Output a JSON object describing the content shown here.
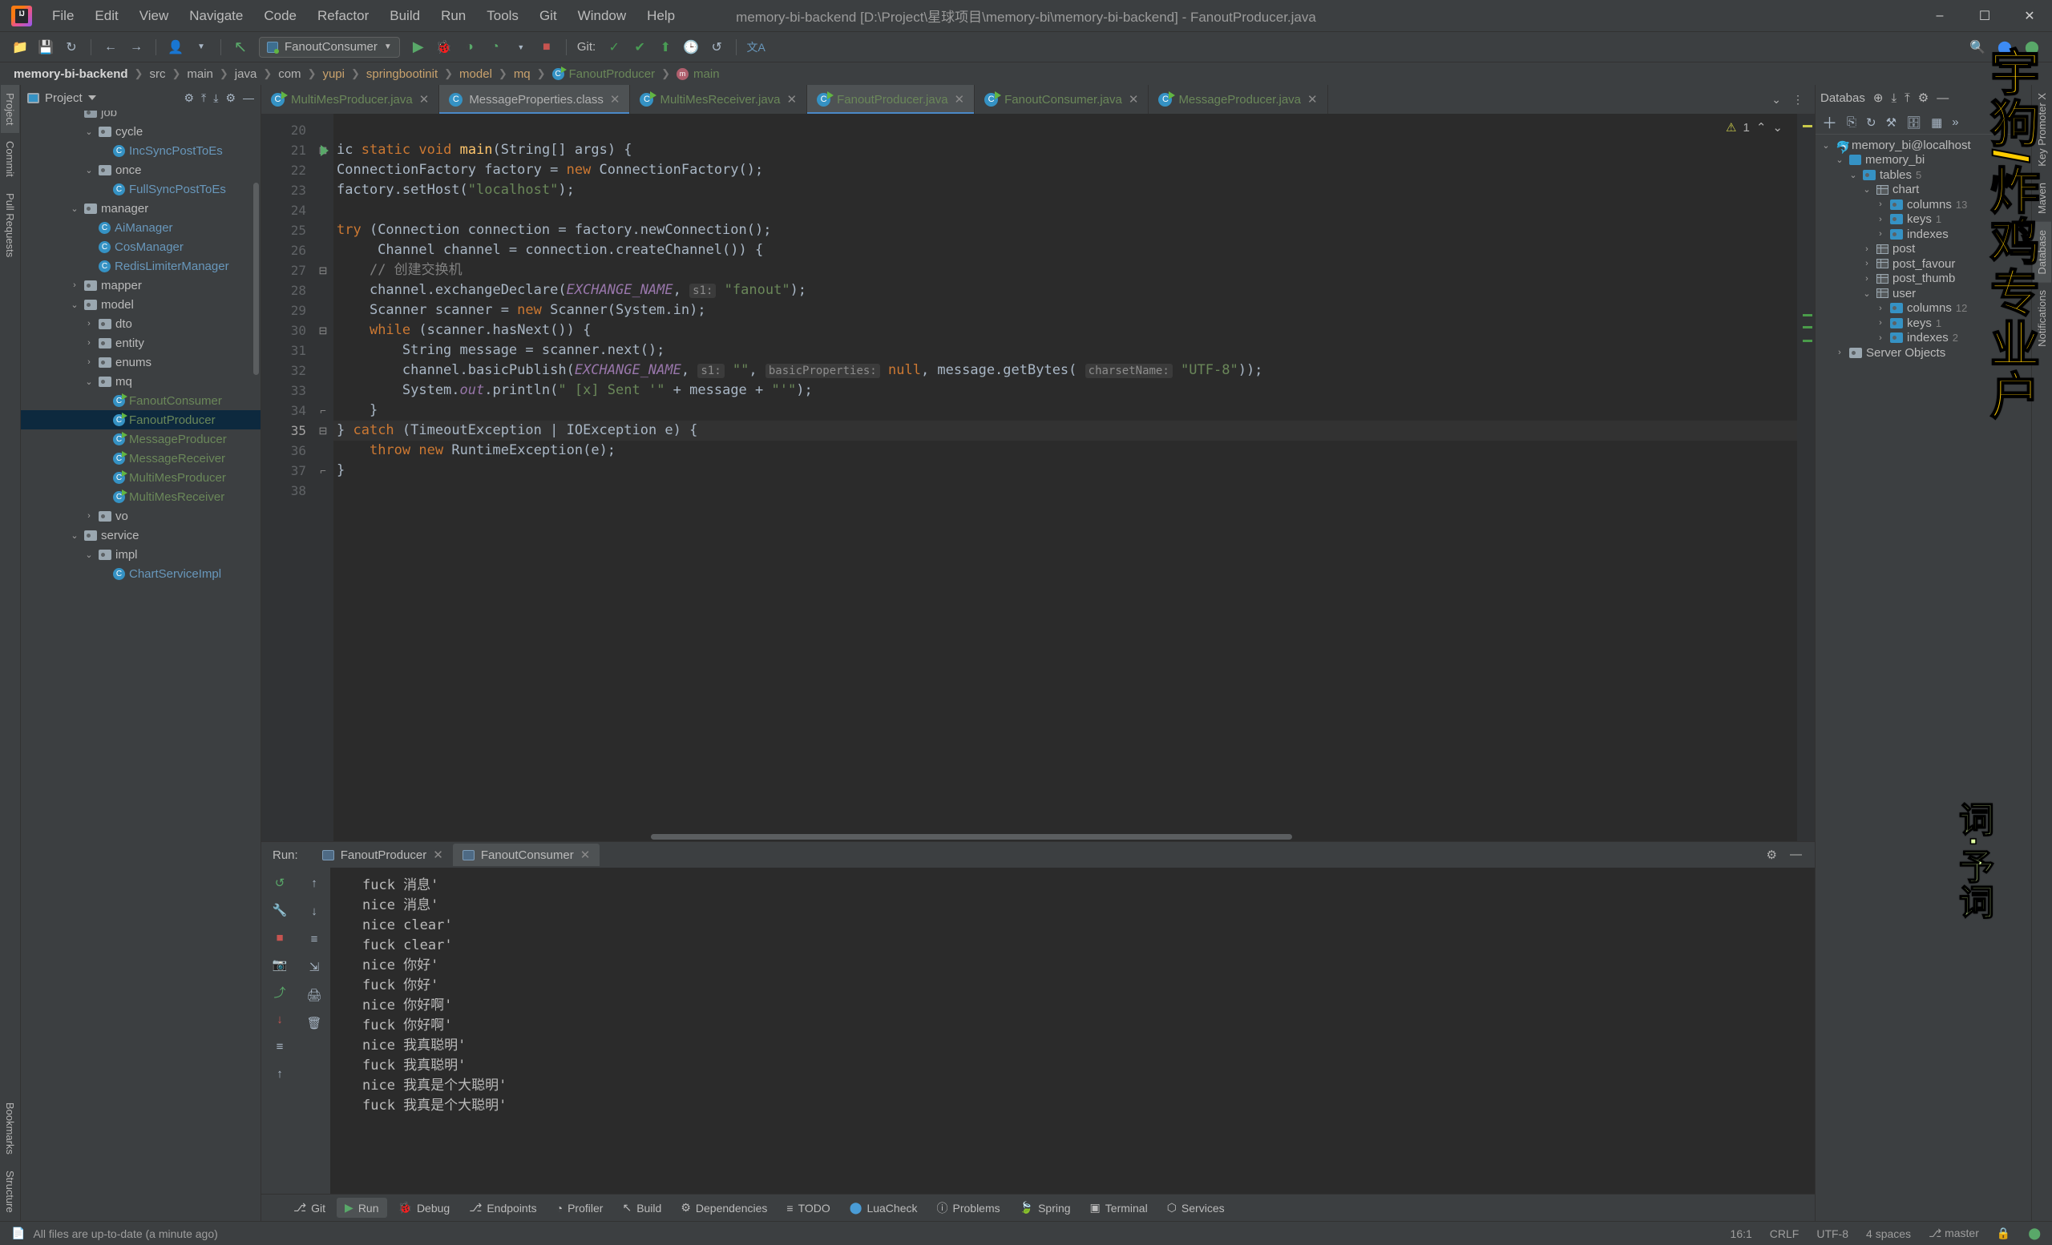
{
  "window": {
    "title": "memory-bi-backend [D:\\Project\\星球项目\\memory-bi\\memory-bi-backend] - FanoutProducer.java",
    "minimize": "–",
    "maximize": "☐",
    "close": "✕"
  },
  "menu": [
    "File",
    "Edit",
    "View",
    "Navigate",
    "Code",
    "Refactor",
    "Build",
    "Run",
    "Tools",
    "Git",
    "Window",
    "Help"
  ],
  "toolbar": {
    "open_icon": "📁",
    "save_icon": "💾",
    "sync_icon": "↻",
    "back_icon": "←",
    "forward_icon": "→",
    "profile_icon": "👤",
    "build_icon": "↖",
    "run_config": "FanoutConsumer",
    "run_icon": "▶",
    "debug_icon": "🐞",
    "coverage_icon": "◑",
    "profiler_icon": "◔",
    "stop_icon": "■",
    "git_label": "Git:",
    "git_update_icon": "✓",
    "git_commit_icon": "✔",
    "git_push_icon": "⬆",
    "git_history_icon": "🕒",
    "git_rollback_icon": "↺",
    "translate_icon": "文A",
    "search_icon": "🔍",
    "assistant_icon": "⬤",
    "ide_icon": "⬤"
  },
  "breadcrumb": [
    {
      "label": "memory-bi-backend",
      "type": "project"
    },
    {
      "label": "src",
      "type": "folder"
    },
    {
      "label": "main",
      "type": "folder"
    },
    {
      "label": "java",
      "type": "folder"
    },
    {
      "label": "com",
      "type": "folder"
    },
    {
      "label": "yupi",
      "type": "folder"
    },
    {
      "label": "springbootinit",
      "type": "folder"
    },
    {
      "label": "model",
      "type": "folder"
    },
    {
      "label": "mq",
      "type": "folder"
    },
    {
      "label": "FanoutProducer",
      "type": "class"
    },
    {
      "label": "main",
      "type": "method"
    }
  ],
  "project_panel": {
    "title": "Project",
    "settings_icon": "⚙",
    "collapse_icon": "⤓",
    "expand_icon": "⤒",
    "gear_icon": "⚙",
    "hide_icon": "—",
    "tree": [
      {
        "indent": 3,
        "arrow": "",
        "icon": "folder",
        "label": "job",
        "color": "plain",
        "cut": true
      },
      {
        "indent": 4,
        "arrow": "v",
        "icon": "folder",
        "label": "cycle",
        "color": "plain"
      },
      {
        "indent": 5,
        "arrow": "",
        "icon": "class",
        "label": "IncSyncPostToEs",
        "color": "blue"
      },
      {
        "indent": 4,
        "arrow": "v",
        "icon": "folder",
        "label": "once",
        "color": "plain"
      },
      {
        "indent": 5,
        "arrow": "",
        "icon": "class",
        "label": "FullSyncPostToEs",
        "color": "blue"
      },
      {
        "indent": 3,
        "arrow": "v",
        "icon": "folder",
        "label": "manager",
        "color": "plain"
      },
      {
        "indent": 4,
        "arrow": "",
        "icon": "class",
        "label": "AiManager",
        "color": "blue"
      },
      {
        "indent": 4,
        "arrow": "",
        "icon": "class",
        "label": "CosManager",
        "color": "blue"
      },
      {
        "indent": 4,
        "arrow": "",
        "icon": "class",
        "label": "RedisLimiterManager",
        "color": "blue"
      },
      {
        "indent": 3,
        "arrow": ">",
        "icon": "folder",
        "label": "mapper",
        "color": "plain"
      },
      {
        "indent": 3,
        "arrow": "v",
        "icon": "folder",
        "label": "model",
        "color": "plain"
      },
      {
        "indent": 4,
        "arrow": ">",
        "icon": "folder",
        "label": "dto",
        "color": "plain"
      },
      {
        "indent": 4,
        "arrow": ">",
        "icon": "folder",
        "label": "entity",
        "color": "plain"
      },
      {
        "indent": 4,
        "arrow": ">",
        "icon": "folder",
        "label": "enums",
        "color": "plain"
      },
      {
        "indent": 4,
        "arrow": "v",
        "icon": "folder",
        "label": "mq",
        "color": "plain"
      },
      {
        "indent": 5,
        "arrow": "",
        "icon": "runclass",
        "label": "FanoutConsumer",
        "color": "green"
      },
      {
        "indent": 5,
        "arrow": "",
        "icon": "runclass",
        "label": "FanoutProducer",
        "color": "green",
        "selected": true
      },
      {
        "indent": 5,
        "arrow": "",
        "icon": "runclass",
        "label": "MessageProducer",
        "color": "green"
      },
      {
        "indent": 5,
        "arrow": "",
        "icon": "runclass",
        "label": "MessageReceiver",
        "color": "green"
      },
      {
        "indent": 5,
        "arrow": "",
        "icon": "runclass",
        "label": "MultiMesProducer",
        "color": "green"
      },
      {
        "indent": 5,
        "arrow": "",
        "icon": "runclass",
        "label": "MultiMesReceiver",
        "color": "green"
      },
      {
        "indent": 4,
        "arrow": ">",
        "icon": "folder",
        "label": "vo",
        "color": "plain"
      },
      {
        "indent": 3,
        "arrow": "v",
        "icon": "folder",
        "label": "service",
        "color": "plain"
      },
      {
        "indent": 4,
        "arrow": "v",
        "icon": "folder",
        "label": "impl",
        "color": "plain"
      },
      {
        "indent": 5,
        "arrow": "",
        "icon": "class",
        "label": "ChartServiceImpl",
        "color": "blue"
      }
    ]
  },
  "left_strip": [
    "Project",
    "Commit",
    "Pull Requests"
  ],
  "left_strip_bottom": [
    "Bookmarks",
    "Structure"
  ],
  "editor_tabs": [
    {
      "label": "MultiMesProducer.java",
      "icon": "runclass",
      "active": false
    },
    {
      "label": "MessageProperties.class",
      "icon": "class",
      "active": true,
      "grey": true
    },
    {
      "label": "MultiMesReceiver.java",
      "icon": "runclass",
      "active": false
    },
    {
      "label": "FanoutProducer.java",
      "icon": "runclass",
      "active": true
    },
    {
      "label": "FanoutConsumer.java",
      "icon": "runclass",
      "active": false
    },
    {
      "label": "MessageProducer.java",
      "icon": "runclass",
      "active": false
    }
  ],
  "editor_tabs_right": {
    "chevron": "⌄",
    "more": "⋮"
  },
  "editor": {
    "warning_count": "1",
    "warning_icon": "⚠",
    "up_icon": "⌃",
    "down_icon": "⌄",
    "lines": [
      {
        "n": "20",
        "text": "",
        "partial": true
      },
      {
        "n": "21",
        "text": "ic static void main(String[] args) {",
        "run": true,
        "fold": "-"
      },
      {
        "n": "22",
        "text": "ConnectionFactory factory = new ConnectionFactory();"
      },
      {
        "n": "23",
        "text": "factory.setHost(\"localhost\");"
      },
      {
        "n": "24",
        "text": ""
      },
      {
        "n": "25",
        "text": "try (Connection connection = factory.newConnection();"
      },
      {
        "n": "26",
        "text": "     Channel channel = connection.createChannel()) {"
      },
      {
        "n": "27",
        "text": "    // 创建交换机",
        "fold": "-"
      },
      {
        "n": "28",
        "text": "    channel.exchangeDeclare(EXCHANGE_NAME, s1: \"fanout\");"
      },
      {
        "n": "29",
        "text": "    Scanner scanner = new Scanner(System.in);"
      },
      {
        "n": "30",
        "text": "    while (scanner.hasNext()) {",
        "fold": "-"
      },
      {
        "n": "31",
        "text": "        String message = scanner.next();"
      },
      {
        "n": "32",
        "text": "        channel.basicPublish(EXCHANGE_NAME, s1: \"\", basicProperties: null, message.getBytes( charsetName: \"UTF-8\"));"
      },
      {
        "n": "33",
        "text": "        System.out.println(\" [x] Sent '\" + message + \"'\");"
      },
      {
        "n": "34",
        "text": "    }",
        "fold": "end"
      },
      {
        "n": "35",
        "text": "} catch (TimeoutException | IOException e) {",
        "current": true,
        "fold": "-"
      },
      {
        "n": "36",
        "text": "    throw new RuntimeException(e);"
      },
      {
        "n": "37",
        "text": "}",
        "fold": "end"
      },
      {
        "n": "38",
        "text": ""
      }
    ]
  },
  "run_panel": {
    "label": "Run:",
    "tabs": [
      {
        "label": "FanoutProducer",
        "active": false,
        "close": "✕"
      },
      {
        "label": "FanoutConsumer",
        "active": true,
        "close": "✕"
      }
    ],
    "gear_icon": "⚙",
    "hide_icon": "—",
    "side_icons": [
      "↺",
      "🔧",
      "■",
      "📷",
      "⤴",
      "↓",
      "↑",
      "≡",
      "🖨",
      "🗑"
    ],
    "console_lines": [
      "fuck 消息'",
      "nice 消息'",
      "nice clear'",
      "fuck clear'",
      "nice 你好'",
      "fuck 你好'",
      "nice 你好啊'",
      "fuck 你好啊'",
      "nice 我真聪明'",
      "fuck 我真聪明'",
      "nice 我真是个大聪明'",
      "fuck 我真是个大聪明'"
    ]
  },
  "tool_windows": [
    {
      "label": "Git",
      "icon": "⎇",
      "selected": false
    },
    {
      "label": "Run",
      "icon": "▶",
      "selected": true
    },
    {
      "label": "Debug",
      "icon": "🐞",
      "selected": false
    },
    {
      "label": "Endpoints",
      "icon": "⎇",
      "selected": false
    },
    {
      "label": "Profiler",
      "icon": "◔",
      "selected": false
    },
    {
      "label": "Build",
      "icon": "↖",
      "selected": false
    },
    {
      "label": "Dependencies",
      "icon": "⚙",
      "selected": false
    },
    {
      "label": "TODO",
      "icon": "≡",
      "selected": false
    },
    {
      "label": "LuaCheck",
      "icon": "⬤",
      "selected": false
    },
    {
      "label": "Problems",
      "icon": "ⓘ",
      "selected": false
    },
    {
      "label": "Spring",
      "icon": "🍃",
      "selected": false
    },
    {
      "label": "Terminal",
      "icon": "▣",
      "selected": false
    },
    {
      "label": "Services",
      "icon": "⬡",
      "selected": false
    }
  ],
  "status_bar": {
    "message_icon": "📄",
    "message": "All files are up-to-date (a minute ago)",
    "caret": "16:1",
    "line_sep": "CRLF",
    "encoding": "UTF-8",
    "indent": "4 spaces",
    "branch_icon": "⎇",
    "branch": "master",
    "lock_icon": "🔒",
    "ide_icon": "⬤"
  },
  "database_panel": {
    "title": "Databas",
    "head_icons": [
      "⊕",
      "⤓",
      "⤒",
      "⚙",
      "—"
    ],
    "tool_icons": [
      "＋",
      "⎘",
      "↻",
      "⚒",
      "🗄",
      "▦",
      "»"
    ],
    "tree": [
      {
        "indent": 0,
        "arrow": "v",
        "icon": "conn",
        "label": "memory_bi@localhost",
        "count": ""
      },
      {
        "indent": 1,
        "arrow": "v",
        "icon": "schema",
        "label": "memory_bi",
        "count": ""
      },
      {
        "indent": 2,
        "arrow": "v",
        "icon": "folder",
        "label": "tables",
        "count": "5"
      },
      {
        "indent": 3,
        "arrow": "v",
        "icon": "table",
        "label": "chart",
        "count": ""
      },
      {
        "indent": 4,
        "arrow": ">",
        "icon": "folder",
        "label": "columns",
        "count": "13"
      },
      {
        "indent": 4,
        "arrow": ">",
        "icon": "folder",
        "label": "keys",
        "count": "1"
      },
      {
        "indent": 4,
        "arrow": ">",
        "icon": "folder",
        "label": "indexes",
        "count": ""
      },
      {
        "indent": 3,
        "arrow": ">",
        "icon": "table",
        "label": "post",
        "count": ""
      },
      {
        "indent": 3,
        "arrow": ">",
        "icon": "table",
        "label": "post_favour",
        "count": ""
      },
      {
        "indent": 3,
        "arrow": ">",
        "icon": "table",
        "label": "post_thumb",
        "count": ""
      },
      {
        "indent": 3,
        "arrow": "v",
        "icon": "table",
        "label": "user",
        "count": ""
      },
      {
        "indent": 4,
        "arrow": ">",
        "icon": "folder",
        "label": "columns",
        "count": "12"
      },
      {
        "indent": 4,
        "arrow": ">",
        "icon": "folder",
        "label": "keys",
        "count": "1"
      },
      {
        "indent": 4,
        "arrow": ">",
        "icon": "folder",
        "label": "indexes",
        "count": "2"
      },
      {
        "indent": 1,
        "arrow": ">",
        "icon": "server",
        "label": "Server Objects",
        "count": ""
      }
    ]
  },
  "right_strip": [
    "Key Promoter X",
    "Maven",
    "Database",
    "Notifications"
  ],
  "watermark": {
    "line1": "宇狗/炸鸡专业户",
    "line2": "词·予词"
  }
}
